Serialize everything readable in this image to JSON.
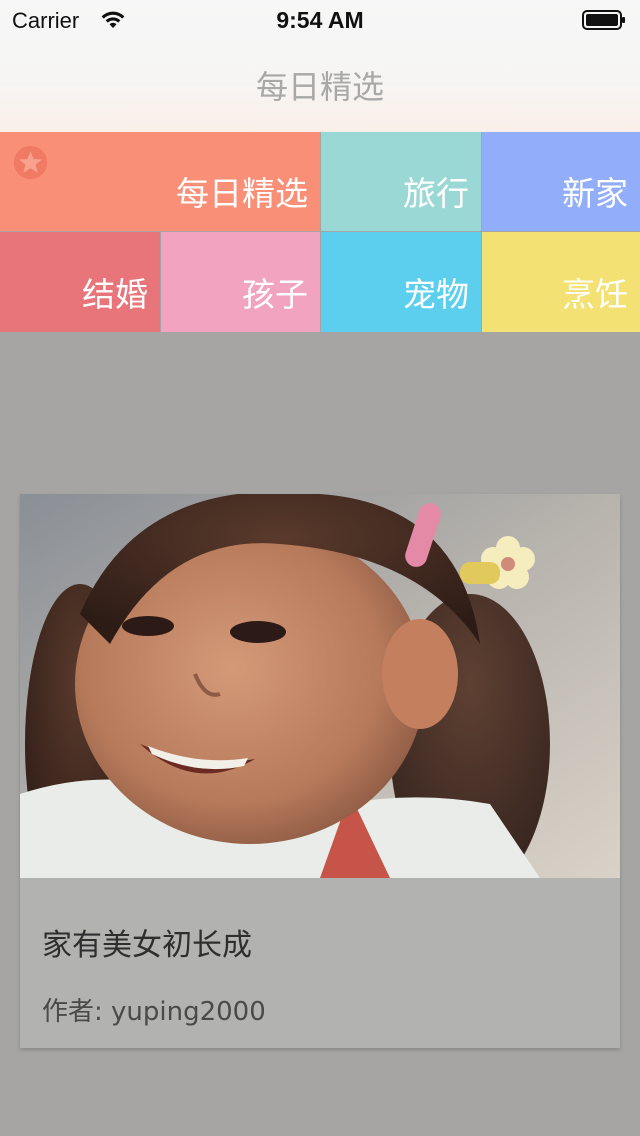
{
  "status_bar": {
    "carrier": "Carrier",
    "time": "9:54 AM",
    "wifi_icon": "wifi-icon",
    "battery_icon": "battery-icon"
  },
  "nav": {
    "title": "每日精选"
  },
  "categories": [
    {
      "label": "每日精选",
      "color": "#f98f77",
      "selected": true,
      "icon": "star-icon"
    },
    {
      "label": "旅行",
      "color": "#9ad8d6"
    },
    {
      "label": "新家",
      "color": "#92aefa"
    },
    {
      "label": "结婚",
      "color": "#e8757a"
    },
    {
      "label": "孩子",
      "color": "#f1a3c0"
    },
    {
      "label": "宠物",
      "color": "#5ccfee"
    },
    {
      "label": "烹饪",
      "color": "#f3e273"
    }
  ],
  "card": {
    "title": "家有美女初长成",
    "author": "作者: yuping2000"
  }
}
